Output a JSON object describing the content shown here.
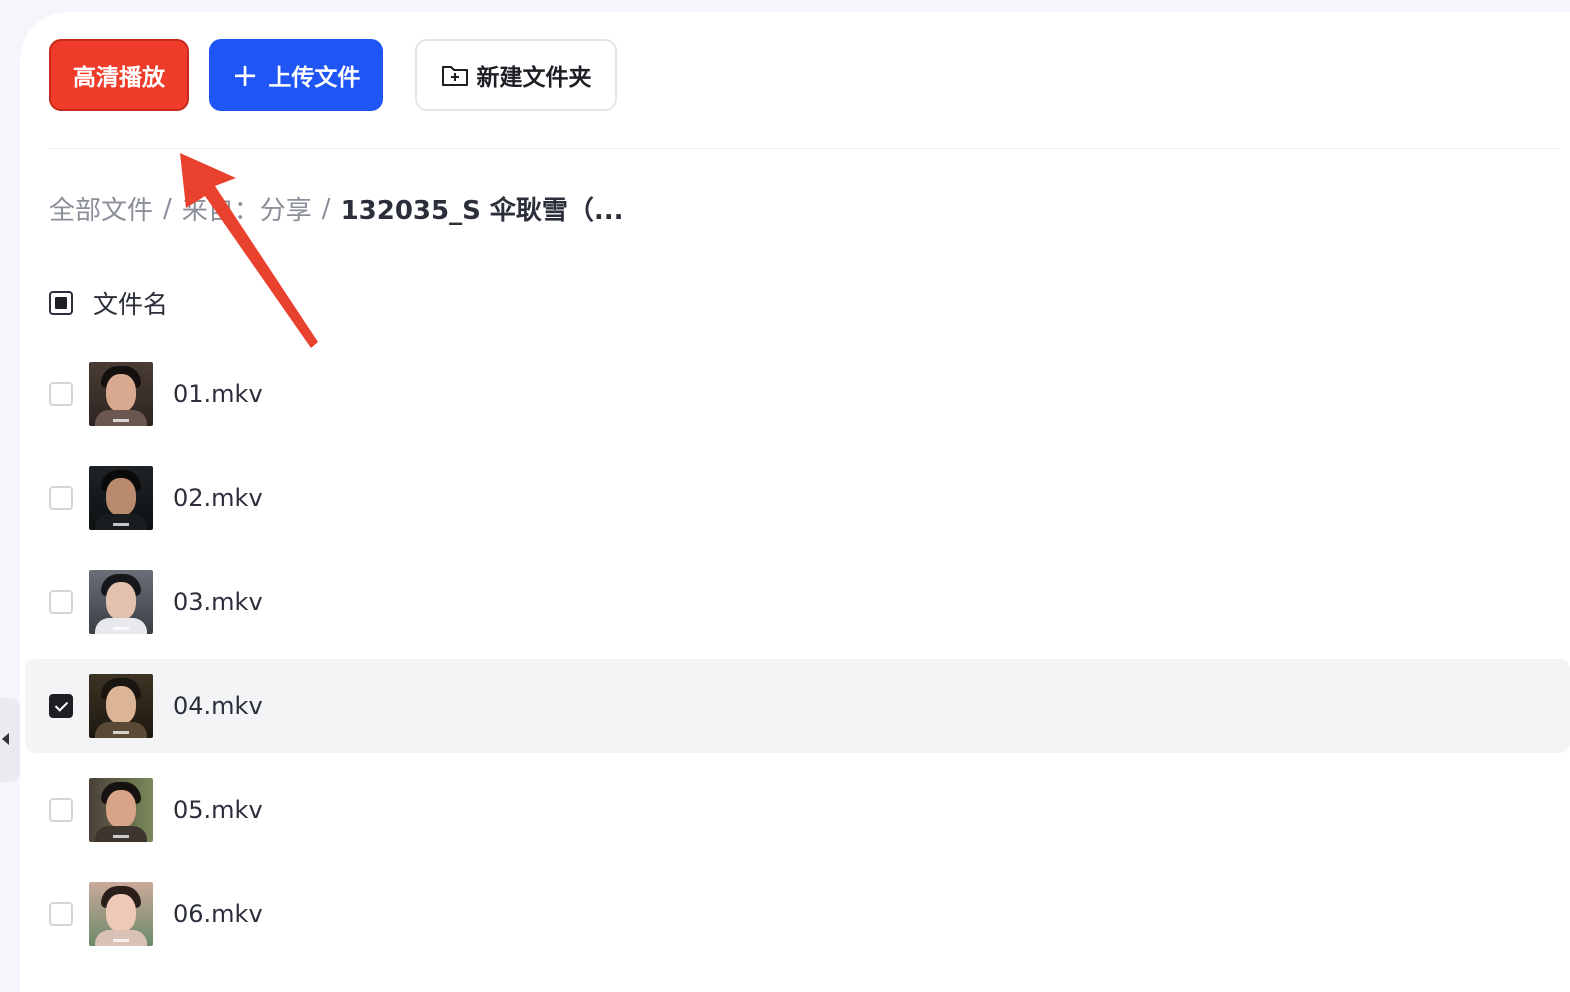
{
  "toolbar": {
    "hd_play_label": "高清播放",
    "upload_label": "上传文件",
    "upload_plus": "+",
    "new_folder_label": "新建文件夹"
  },
  "breadcrumb": {
    "items": [
      "全部文件",
      "来自：分享",
      "132035_S 伞耿雪（..."
    ],
    "separator": "/"
  },
  "list": {
    "header_label": "文件名",
    "files": [
      {
        "name": "01.mkv",
        "checked": false
      },
      {
        "name": "02.mkv",
        "checked": false
      },
      {
        "name": "03.mkv",
        "checked": false
      },
      {
        "name": "04.mkv",
        "checked": true
      },
      {
        "name": "05.mkv",
        "checked": false
      },
      {
        "name": "06.mkv",
        "checked": false
      }
    ]
  },
  "colors": {
    "hd_button": "#ef3b2a",
    "upload_button": "#1f55f5",
    "annotation_arrow": "#e8412d",
    "selected_row": "#f3f4f6"
  },
  "icons": {
    "upload": "plus-icon",
    "new_folder": "folder-plus-icon",
    "side_tab": "triangle-left-icon"
  }
}
